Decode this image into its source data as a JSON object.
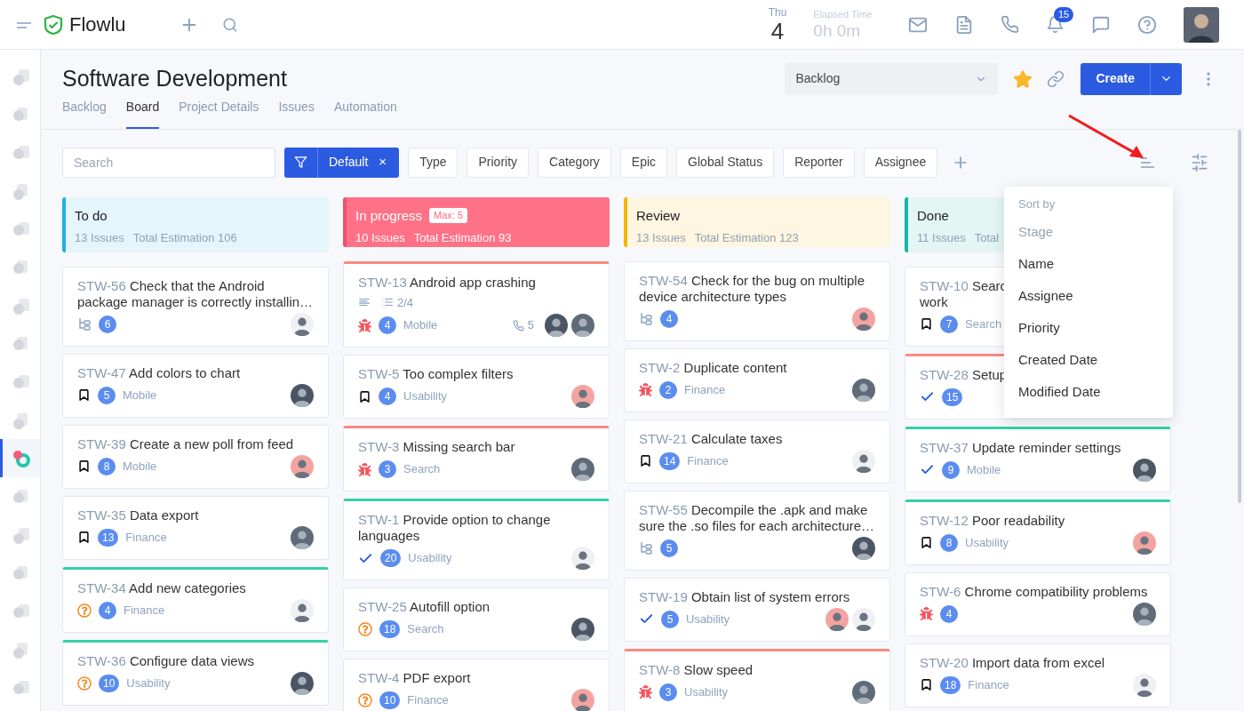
{
  "topbar": {
    "app_name": "Flowlu",
    "day_name": "Thu",
    "day_number": "4",
    "elapsed_label": "Elapsed Time",
    "elapsed_value": "0h 0m",
    "notification_count": "15"
  },
  "sidebar": {
    "items": [
      {
        "selected": false
      },
      {
        "selected": false
      },
      {
        "selected": false
      },
      {
        "selected": false
      },
      {
        "selected": false
      },
      {
        "selected": false
      },
      {
        "selected": false
      },
      {
        "selected": false
      },
      {
        "selected": false
      },
      {
        "selected": false
      },
      {
        "selected": true
      },
      {
        "selected": false
      },
      {
        "selected": false
      },
      {
        "selected": false
      },
      {
        "selected": false
      },
      {
        "selected": false
      },
      {
        "selected": false
      }
    ]
  },
  "page": {
    "title": "Software Development",
    "view_select": "Backlog",
    "favorite": true,
    "create_label": "Create"
  },
  "tabs": [
    {
      "label": "Backlog",
      "selected": false
    },
    {
      "label": "Board",
      "selected": true
    },
    {
      "label": "Project Details",
      "selected": false
    },
    {
      "label": "Issues",
      "selected": false
    },
    {
      "label": "Automation",
      "selected": false
    }
  ],
  "filters": {
    "search_placeholder": "Search",
    "preset": "Default",
    "preset_clear": "×",
    "chips": [
      "Type",
      "Priority",
      "Category",
      "Epic",
      "Global Status",
      "Reporter",
      "Assignee"
    ]
  },
  "sort_menu": {
    "title": "Sort by",
    "items": [
      {
        "label": "Stage",
        "disabled": true
      },
      {
        "label": "Name",
        "disabled": false
      },
      {
        "label": "Assignee",
        "disabled": false
      },
      {
        "label": "Priority",
        "disabled": false
      },
      {
        "label": "Created Date",
        "disabled": false
      },
      {
        "label": "Modified Date",
        "disabled": false
      }
    ]
  },
  "columns": [
    {
      "name": "To do",
      "color": "#1fb0e6",
      "kind": "tinted",
      "issues": "13 Issues",
      "estimation": "Total Estimation 106",
      "cards": [
        {
          "key": "STW-56",
          "title": "Check that the Android package manager is correctly installin…",
          "kind": "subtasks",
          "count": "6"
        },
        {
          "key": "STW-47",
          "title": "Add colors to chart",
          "kind": "story",
          "count": "5",
          "category": "Mobile"
        },
        {
          "key": "STW-39",
          "title": "Create a new poll from feed",
          "kind": "story",
          "count": "8",
          "category": "Mobile"
        },
        {
          "key": "STW-35",
          "title": "Data export",
          "kind": "story",
          "count": "13",
          "category": "Finance"
        },
        {
          "key": "STW-34",
          "title": "Add new categories",
          "kind": "question",
          "count": "4",
          "category": "Finance",
          "color": "#34d1a8"
        },
        {
          "key": "STW-36",
          "title": "Configure data views",
          "kind": "question",
          "count": "10",
          "category": "Usability",
          "color": "#34d1a8"
        }
      ]
    },
    {
      "name": "In progress",
      "color": "#ff7186",
      "kind": "filled",
      "max_badge": "Max: 5",
      "issues": "10 Issues",
      "estimation": "Total Estimation 93",
      "cards": [
        {
          "key": "STW-13",
          "title": "Android app crashing",
          "kind": "bug",
          "count": "4",
          "category": "Mobile",
          "color": "#f88a82",
          "checklist": "2/4",
          "calls": "5"
        },
        {
          "key": "STW-5",
          "title": "Too complex filters",
          "kind": "story",
          "count": "4",
          "category": "Usability"
        },
        {
          "key": "STW-3",
          "title": "Missing search bar",
          "kind": "bug",
          "count": "3",
          "category": "Search",
          "color": "#f88a82"
        },
        {
          "key": "STW-1",
          "title": "Provide option to change languages",
          "kind": "task",
          "count": "20",
          "category": "Usability",
          "color": "#34d1a8"
        },
        {
          "key": "STW-25",
          "title": "Autofill option",
          "kind": "question",
          "count": "18",
          "category": "Search"
        },
        {
          "key": "STW-4",
          "title": "PDF export",
          "kind": "question",
          "count": "10",
          "category": "Finance"
        }
      ]
    },
    {
      "name": "Review",
      "color": "#f5b400",
      "kind": "tinted",
      "issues": "13 Issues",
      "estimation": "Total Estimation 123",
      "cards": [
        {
          "key": "STW-54",
          "title": "Check for the bug on multiple device architecture types",
          "kind": "subtasks",
          "count": "4"
        },
        {
          "key": "STW-2",
          "title": "Duplicate content",
          "kind": "bug",
          "count": "2",
          "category": "Finance"
        },
        {
          "key": "STW-21",
          "title": "Calculate taxes",
          "kind": "story",
          "count": "14",
          "category": "Finance"
        },
        {
          "key": "STW-55",
          "title": "Decompile the .apk and make sure the .so files for each architecture…",
          "kind": "subtasks",
          "count": "5"
        },
        {
          "key": "STW-19",
          "title": "Obtain list of system errors",
          "kind": "task",
          "count": "5",
          "category": "Usability"
        },
        {
          "key": "STW-8",
          "title": "Slow speed",
          "kind": "bug",
          "count": "3",
          "category": "Usability",
          "color": "#f88a82"
        }
      ]
    },
    {
      "name": "Done",
      "color": "#14b8a6",
      "kind": "tinted",
      "issues": "11 Issues",
      "estimation": "Total",
      "cards": [
        {
          "key": "STW-10",
          "title": "Searc",
          "title_continued": "work",
          "kind": "story",
          "count": "7",
          "category": "Search"
        },
        {
          "key": "STW-28",
          "title": "Setup",
          "kind": "task",
          "count": "15",
          "color": "#f88a82"
        },
        {
          "key": "STW-37",
          "title": "Update reminder settings",
          "kind": "task",
          "count": "9",
          "category": "Mobile",
          "color": "#34d1a8"
        },
        {
          "key": "STW-12",
          "title": "Poor readability",
          "kind": "story",
          "count": "8",
          "category": "Usability",
          "color": "#34d1a8"
        },
        {
          "key": "STW-6",
          "title": "Chrome compatibility problems",
          "kind": "bug",
          "count": "4"
        },
        {
          "key": "STW-20",
          "title": "Import data from excel",
          "kind": "story",
          "count": "18",
          "category": "Finance"
        }
      ]
    }
  ]
}
